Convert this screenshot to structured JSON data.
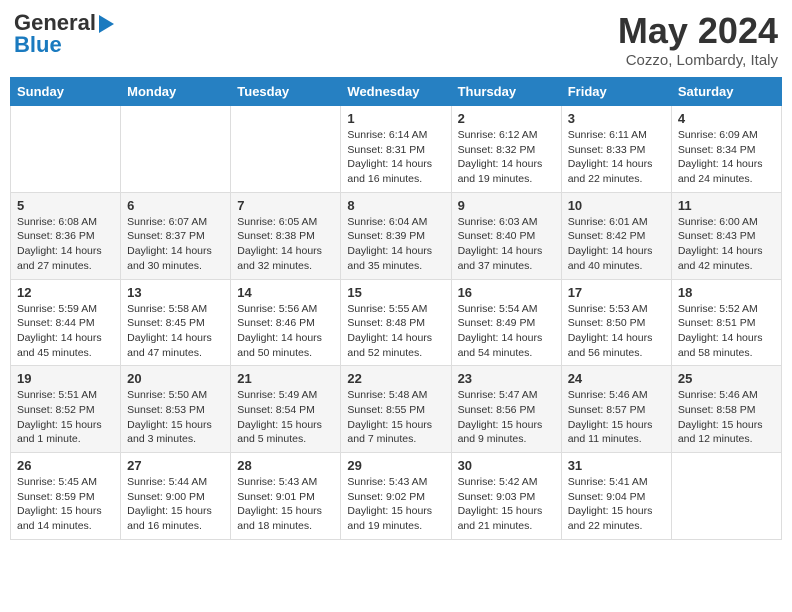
{
  "header": {
    "logo_general": "General",
    "logo_blue": "Blue",
    "month_title": "May 2024",
    "location": "Cozzo, Lombardy, Italy"
  },
  "days_of_week": [
    "Sunday",
    "Monday",
    "Tuesday",
    "Wednesday",
    "Thursday",
    "Friday",
    "Saturday"
  ],
  "weeks": [
    [
      {
        "day": "",
        "content": ""
      },
      {
        "day": "",
        "content": ""
      },
      {
        "day": "",
        "content": ""
      },
      {
        "day": "1",
        "content": "Sunrise: 6:14 AM\nSunset: 8:31 PM\nDaylight: 14 hours and 16 minutes."
      },
      {
        "day": "2",
        "content": "Sunrise: 6:12 AM\nSunset: 8:32 PM\nDaylight: 14 hours and 19 minutes."
      },
      {
        "day": "3",
        "content": "Sunrise: 6:11 AM\nSunset: 8:33 PM\nDaylight: 14 hours and 22 minutes."
      },
      {
        "day": "4",
        "content": "Sunrise: 6:09 AM\nSunset: 8:34 PM\nDaylight: 14 hours and 24 minutes."
      }
    ],
    [
      {
        "day": "5",
        "content": "Sunrise: 6:08 AM\nSunset: 8:36 PM\nDaylight: 14 hours and 27 minutes."
      },
      {
        "day": "6",
        "content": "Sunrise: 6:07 AM\nSunset: 8:37 PM\nDaylight: 14 hours and 30 minutes."
      },
      {
        "day": "7",
        "content": "Sunrise: 6:05 AM\nSunset: 8:38 PM\nDaylight: 14 hours and 32 minutes."
      },
      {
        "day": "8",
        "content": "Sunrise: 6:04 AM\nSunset: 8:39 PM\nDaylight: 14 hours and 35 minutes."
      },
      {
        "day": "9",
        "content": "Sunrise: 6:03 AM\nSunset: 8:40 PM\nDaylight: 14 hours and 37 minutes."
      },
      {
        "day": "10",
        "content": "Sunrise: 6:01 AM\nSunset: 8:42 PM\nDaylight: 14 hours and 40 minutes."
      },
      {
        "day": "11",
        "content": "Sunrise: 6:00 AM\nSunset: 8:43 PM\nDaylight: 14 hours and 42 minutes."
      }
    ],
    [
      {
        "day": "12",
        "content": "Sunrise: 5:59 AM\nSunset: 8:44 PM\nDaylight: 14 hours and 45 minutes."
      },
      {
        "day": "13",
        "content": "Sunrise: 5:58 AM\nSunset: 8:45 PM\nDaylight: 14 hours and 47 minutes."
      },
      {
        "day": "14",
        "content": "Sunrise: 5:56 AM\nSunset: 8:46 PM\nDaylight: 14 hours and 50 minutes."
      },
      {
        "day": "15",
        "content": "Sunrise: 5:55 AM\nSunset: 8:48 PM\nDaylight: 14 hours and 52 minutes."
      },
      {
        "day": "16",
        "content": "Sunrise: 5:54 AM\nSunset: 8:49 PM\nDaylight: 14 hours and 54 minutes."
      },
      {
        "day": "17",
        "content": "Sunrise: 5:53 AM\nSunset: 8:50 PM\nDaylight: 14 hours and 56 minutes."
      },
      {
        "day": "18",
        "content": "Sunrise: 5:52 AM\nSunset: 8:51 PM\nDaylight: 14 hours and 58 minutes."
      }
    ],
    [
      {
        "day": "19",
        "content": "Sunrise: 5:51 AM\nSunset: 8:52 PM\nDaylight: 15 hours and 1 minute."
      },
      {
        "day": "20",
        "content": "Sunrise: 5:50 AM\nSunset: 8:53 PM\nDaylight: 15 hours and 3 minutes."
      },
      {
        "day": "21",
        "content": "Sunrise: 5:49 AM\nSunset: 8:54 PM\nDaylight: 15 hours and 5 minutes."
      },
      {
        "day": "22",
        "content": "Sunrise: 5:48 AM\nSunset: 8:55 PM\nDaylight: 15 hours and 7 minutes."
      },
      {
        "day": "23",
        "content": "Sunrise: 5:47 AM\nSunset: 8:56 PM\nDaylight: 15 hours and 9 minutes."
      },
      {
        "day": "24",
        "content": "Sunrise: 5:46 AM\nSunset: 8:57 PM\nDaylight: 15 hours and 11 minutes."
      },
      {
        "day": "25",
        "content": "Sunrise: 5:46 AM\nSunset: 8:58 PM\nDaylight: 15 hours and 12 minutes."
      }
    ],
    [
      {
        "day": "26",
        "content": "Sunrise: 5:45 AM\nSunset: 8:59 PM\nDaylight: 15 hours and 14 minutes."
      },
      {
        "day": "27",
        "content": "Sunrise: 5:44 AM\nSunset: 9:00 PM\nDaylight: 15 hours and 16 minutes."
      },
      {
        "day": "28",
        "content": "Sunrise: 5:43 AM\nSunset: 9:01 PM\nDaylight: 15 hours and 18 minutes."
      },
      {
        "day": "29",
        "content": "Sunrise: 5:43 AM\nSunset: 9:02 PM\nDaylight: 15 hours and 19 minutes."
      },
      {
        "day": "30",
        "content": "Sunrise: 5:42 AM\nSunset: 9:03 PM\nDaylight: 15 hours and 21 minutes."
      },
      {
        "day": "31",
        "content": "Sunrise: 5:41 AM\nSunset: 9:04 PM\nDaylight: 15 hours and 22 minutes."
      },
      {
        "day": "",
        "content": ""
      }
    ]
  ]
}
